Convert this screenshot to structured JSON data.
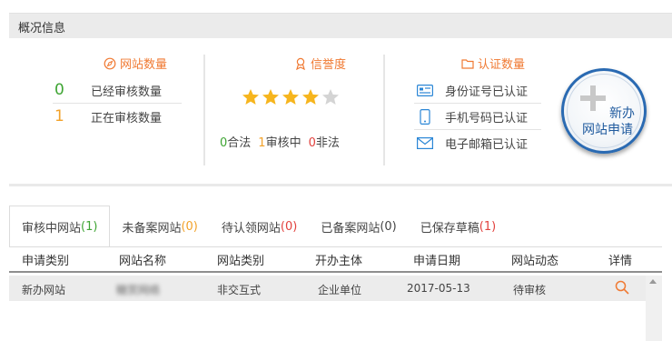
{
  "header": {
    "title": "概况信息"
  },
  "site_count": {
    "title": "网站数量",
    "rows": [
      {
        "value": "0",
        "label": "已经审核数量"
      },
      {
        "value": "1",
        "label": "正在审核数量"
      }
    ]
  },
  "reputation": {
    "title": "信誉度",
    "stars_filled": 4,
    "stars_total": 5,
    "legal_count": "0",
    "legal_label": "合法",
    "review_count": "1",
    "review_label": "审核中",
    "illegal_count": "0",
    "illegal_label": "非法"
  },
  "certification": {
    "title": "认证数量",
    "items": [
      {
        "icon": "id-card-icon",
        "label": "身份证号已认证"
      },
      {
        "icon": "phone-icon",
        "label": "手机号码已认证"
      },
      {
        "icon": "envelope-icon",
        "label": "电子邮箱已认证"
      }
    ]
  },
  "new_site_button": {
    "line1": "新办",
    "line2": "网站申请"
  },
  "tabs": [
    {
      "label": "审核中网站",
      "count": "(1)"
    },
    {
      "label": "未备案网站",
      "count": "(0)"
    },
    {
      "label": "待认领网站",
      "count": "(0)"
    },
    {
      "label": "已备案网站",
      "count": "(0)"
    },
    {
      "label": "已保存草稿",
      "count": "(1)"
    }
  ],
  "table": {
    "headers": [
      "申请类别",
      "网站名称",
      "网站类别",
      "开办主体",
      "申请日期",
      "网站动态",
      "详情"
    ],
    "rows": [
      {
        "category": "新办网站",
        "name": "糖赏网络",
        "type": "非交互式",
        "owner": "企业单位",
        "date": "2017-05-13",
        "status": "待审核"
      }
    ]
  },
  "colors": {
    "accent": "#f07a33",
    "green": "#3fa534",
    "orange": "#f2a22a",
    "red": "#e2423e",
    "star": "#f6b51e",
    "button_blue": "#2a6ab2"
  }
}
